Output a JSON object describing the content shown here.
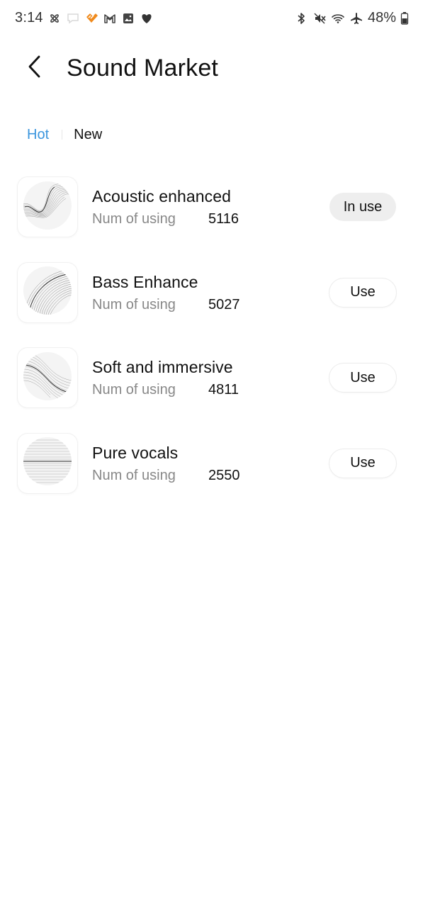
{
  "status_bar": {
    "time": "3:14",
    "battery": "48%",
    "left_icons": [
      "pinwheel-icon",
      "chat-bubble-icon",
      "heart-app-icon",
      "gmail-icon",
      "gallery-icon",
      "heart-icon"
    ],
    "right_icons": [
      "bluetooth-icon",
      "mute-icon",
      "wifi-icon",
      "airplane-icon",
      "battery-icon"
    ]
  },
  "header": {
    "title": "Sound Market",
    "back_icon": "chevron-left-icon"
  },
  "tabs": [
    {
      "label": "Hot",
      "active": true
    },
    {
      "label": "New",
      "active": false
    }
  ],
  "colors": {
    "accent": "#3b96de",
    "secondary_text": "#888888",
    "in_use_bg": "#eeeeee"
  },
  "items": [
    {
      "name": "Acoustic enhanced",
      "meta_label": "Num of using",
      "count": "5116",
      "button": "In use",
      "in_use": true,
      "thumb": "acoustic-wave-icon"
    },
    {
      "name": "Bass Enhance",
      "meta_label": "Num of using",
      "count": "5027",
      "button": "Use",
      "in_use": false,
      "thumb": "bass-wave-icon"
    },
    {
      "name": "Soft and immersive",
      "meta_label": "Num of using",
      "count": "4811",
      "button": "Use",
      "in_use": false,
      "thumb": "soft-wave-icon"
    },
    {
      "name": "Pure vocals",
      "meta_label": "Num of using",
      "count": "2550",
      "button": "Use",
      "in_use": false,
      "thumb": "vocals-wave-icon"
    }
  ]
}
